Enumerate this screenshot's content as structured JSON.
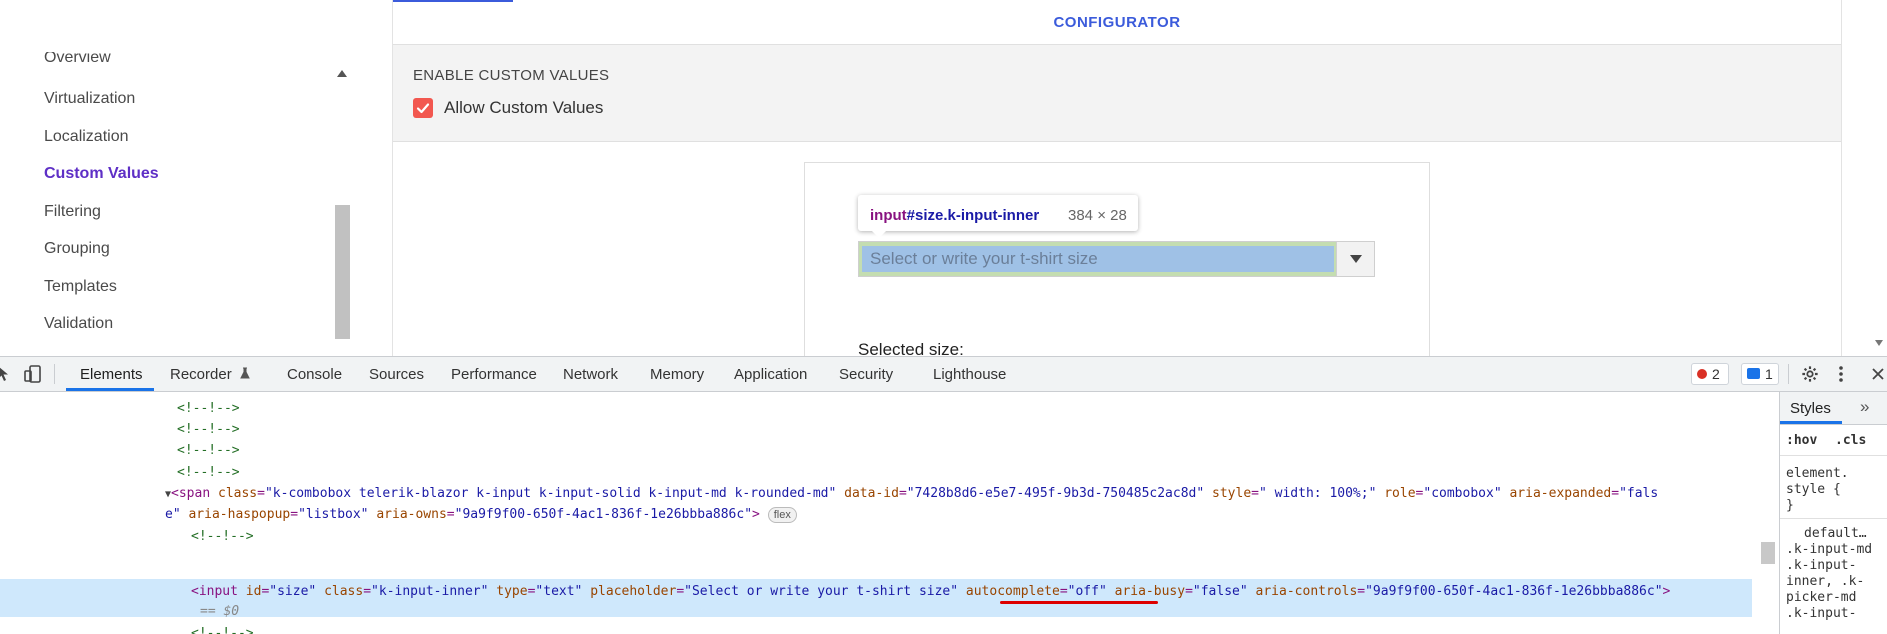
{
  "sidebar": {
    "items": [
      {
        "label": "Overview",
        "active": false
      },
      {
        "label": "Virtualization",
        "active": false
      },
      {
        "label": "Localization",
        "active": false
      },
      {
        "label": "Custom Values",
        "active": true
      },
      {
        "label": "Filtering",
        "active": false
      },
      {
        "label": "Grouping",
        "active": false
      },
      {
        "label": "Templates",
        "active": false
      },
      {
        "label": "Validation",
        "active": false
      }
    ]
  },
  "configurator": {
    "title": "CONFIGURATOR",
    "section_label": "ENABLE CUSTOM VALUES",
    "checkbox_label": "Allow Custom Values",
    "checkbox_checked": true,
    "accent_color": "#f2574f"
  },
  "demo": {
    "combo_placeholder": "Select or write your t-shirt size",
    "selected_label": "Selected size:"
  },
  "tooltip": {
    "tag": "input",
    "selector": "#size.k-input-inner",
    "size": "384 × 28"
  },
  "devtools": {
    "tabs": [
      "Elements",
      "Recorder",
      "Console",
      "Sources",
      "Performance",
      "Network",
      "Memory",
      "Application",
      "Security",
      "Lighthouse"
    ],
    "active_tab": "Elements",
    "errors_count": "2",
    "messages_count": "1",
    "code": {
      "comment": "<!--!-->",
      "span_open": "<span",
      "span_class_attr": "class",
      "span_class_val": "\"k-combobox telerik-blazor k-input k-input-solid k-input-md k-rounded-md\"",
      "span_dataid_attr": "data-id",
      "span_dataid_val": "\"7428b8d6-e5e7-495f-9b3d-750485c2ac8d\"",
      "span_style_attr": "style",
      "span_style_val": "\" width: 100%;\"",
      "span_role_attr": "role",
      "span_role_val": "\"combobox\"",
      "span_expanded_attr": "aria-expanded",
      "span_expanded_val_part1": "\"fals",
      "span_expanded_val_part2": "e\"",
      "span_haspopup_attr": "aria-haspopup",
      "span_haspopup_val": "\"listbox\"",
      "span_owns_attr": "aria-owns",
      "span_owns_val": "\"9a9f9f00-650f-4ac1-836f-1e26bbba886c\"",
      "span_close": ">",
      "flex_badge": "flex",
      "input_open": "<input",
      "input_id_attr": "id",
      "input_id_val": "\"size\"",
      "input_class_attr": "class",
      "input_class_val": "\"k-input-inner\"",
      "input_type_attr": "type",
      "input_type_val": "\"text\"",
      "input_placeholder_attr": "placeholder",
      "input_placeholder_val": "\"Select or write your t-shirt size\"",
      "input_autocomplete_attr": "autocomplete",
      "input_autocomplete_val": "\"off\"",
      "input_busy_attr": "aria-busy",
      "input_busy_val": "\"false\"",
      "input_controls_attr": "aria-controls",
      "input_controls_val": "\"9a9f9f00-650f-4ac1-836f-1e26bbba886c\"",
      "input_close": ">",
      "selected_marker": "== $0"
    }
  },
  "styles_pane": {
    "tab_label": "Styles",
    "more": "»",
    "filter_hov": ":hov",
    "filter_cls": ".cls",
    "lines": [
      "element.",
      "style {",
      "}",
      "default…",
      ".k-input-md",
      ".k-input-",
      "inner, .k-",
      "picker-md",
      ".k-input-"
    ]
  }
}
